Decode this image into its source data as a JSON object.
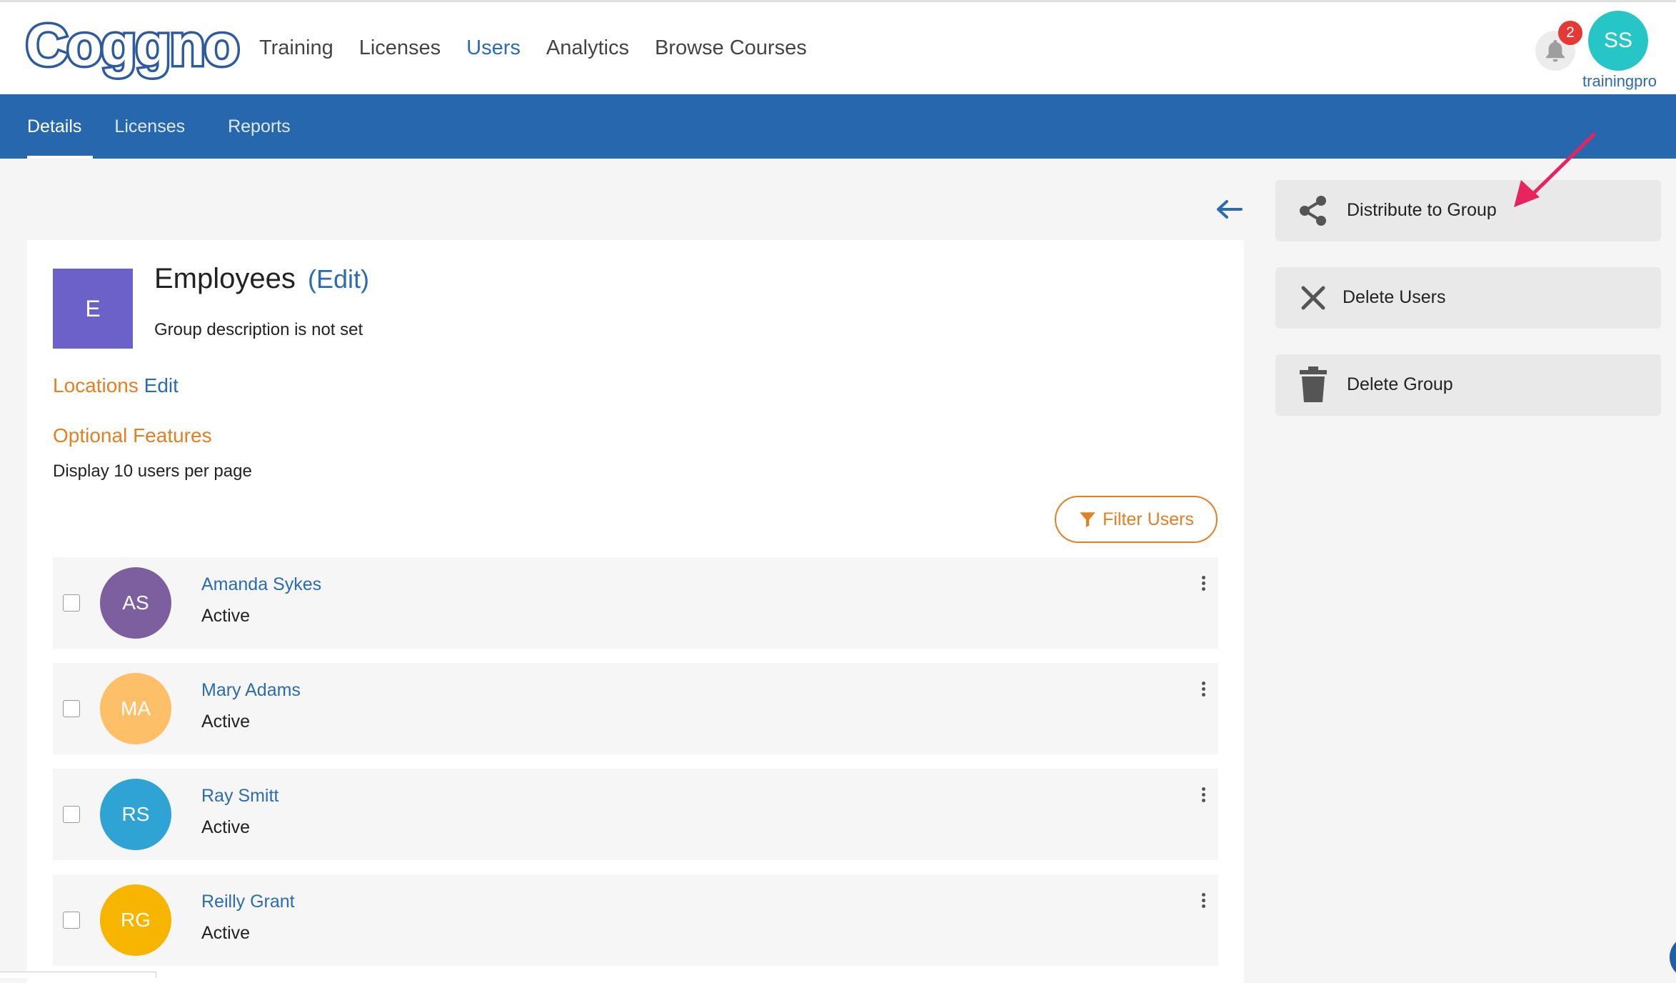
{
  "brand": {
    "logo_text": "Coggno"
  },
  "main_nav": {
    "items": [
      {
        "label": "Training",
        "active": false
      },
      {
        "label": "Licenses",
        "active": false
      },
      {
        "label": "Users",
        "active": true
      },
      {
        "label": "Analytics",
        "active": false
      },
      {
        "label": "Browse Courses",
        "active": false
      }
    ]
  },
  "notifications": {
    "count": "2"
  },
  "user": {
    "initials": "SS",
    "username": "trainingpro"
  },
  "sub_nav": {
    "items": [
      {
        "label": "Details",
        "active": true
      },
      {
        "label": "Licenses",
        "active": false
      },
      {
        "label": "Reports",
        "active": false
      }
    ]
  },
  "group": {
    "badge": "E",
    "title": "Employees",
    "edit_label": "(Edit)",
    "description": "Group description is not set",
    "locations_label": "Locations",
    "locations_edit": "Edit",
    "optional_features_label": "Optional Features",
    "per_page_text": "Display 10 users per page"
  },
  "filter": {
    "label": "Filter Users"
  },
  "users": [
    {
      "initials": "AS",
      "name": "Amanda Sykes",
      "status": "Active",
      "color": "#7d5fa0"
    },
    {
      "initials": "MA",
      "name": "Mary Adams",
      "status": "Active",
      "color": "#fdc068"
    },
    {
      "initials": "RS",
      "name": "Ray Smitt",
      "status": "Active",
      "color": "#2ea3d4"
    },
    {
      "initials": "RG",
      "name": "Reilly Grant",
      "status": "Active",
      "color": "#f8b500"
    }
  ],
  "actions": {
    "distribute": {
      "label": "Distribute to Group",
      "icon": "share-icon"
    },
    "delete_users": {
      "label": "Delete Users",
      "icon": "close-icon"
    },
    "delete_group": {
      "label": "Delete Group",
      "icon": "trash-icon"
    }
  },
  "colors": {
    "primary_blue": "#2767ae",
    "link_blue": "#2b6cb0",
    "accent_orange": "#e67e22",
    "annotation_pink": "#e8245f"
  }
}
